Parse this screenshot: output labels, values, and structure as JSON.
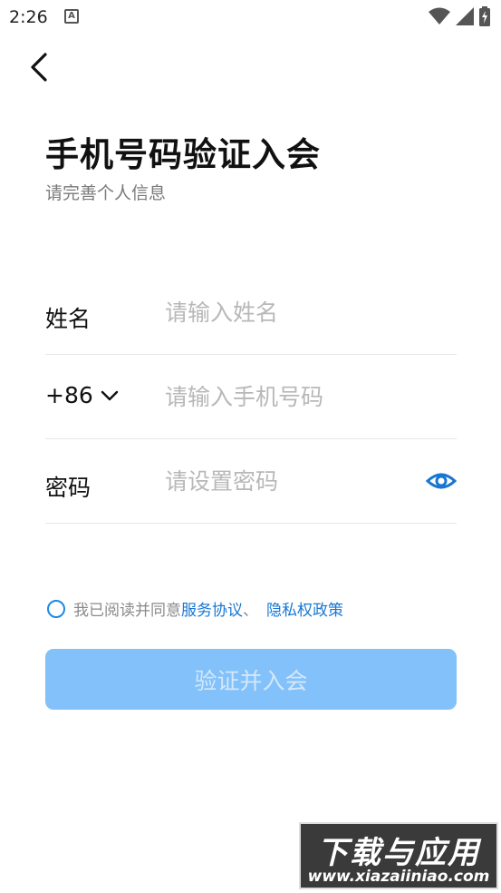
{
  "status_bar": {
    "time": "2:26",
    "notification_icon": "A",
    "icons": [
      "wifi-icon",
      "signal-icon",
      "battery-charging-icon"
    ]
  },
  "header": {
    "back_icon": "chevron-left-icon",
    "title": "手机号码验证入会",
    "subtitle": "请完善个人信息"
  },
  "form": {
    "name": {
      "label": "姓名",
      "value": "",
      "placeholder": "请输入姓名"
    },
    "phone": {
      "country_code": "+86",
      "dropdown_icon": "chevron-down-icon",
      "value": "",
      "placeholder": "请输入手机号码"
    },
    "password": {
      "label": "密码",
      "value": "",
      "placeholder": "请设置密码",
      "toggle_icon": "eye-icon"
    }
  },
  "agreement": {
    "checked": false,
    "prefix": "我已阅读并同意",
    "link_service": "服务协议",
    "separator": "、",
    "link_privacy": "隐私权政策"
  },
  "submit_label": "验证并入会",
  "watermark": {
    "top": "下载与应用",
    "bottom": "www.xiazaiiniao.com"
  },
  "colors": {
    "accent": "#1877d2",
    "button_disabled": "#83c1fa",
    "placeholder": "#b8b8b8"
  }
}
